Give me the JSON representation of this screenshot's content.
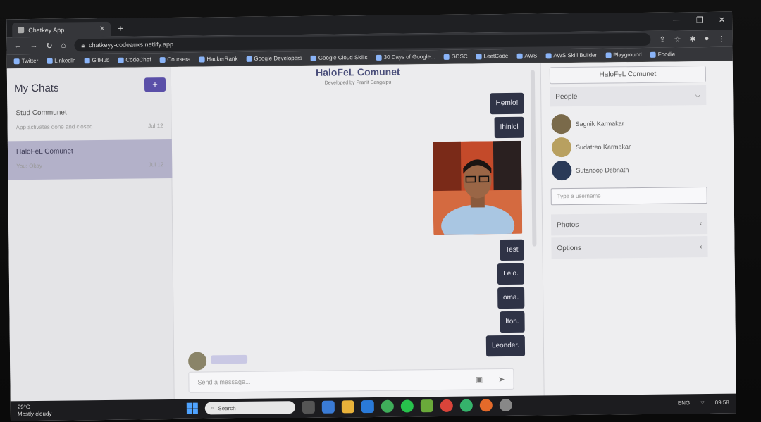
{
  "browser": {
    "tab_title": "Chatkey App",
    "url": "chatkeyy-codeauxs.netlify.app",
    "bookmarks": [
      "Twitter",
      "LinkedIn",
      "GitHub",
      "CodeChef",
      "Coursera",
      "HackerRank",
      "Google Developers",
      "Google Cloud Skills",
      "30 Days of Google...",
      "GDSC",
      "LeetCode",
      "AWS",
      "AWS Skill Builder",
      "Playground",
      "Foodie"
    ]
  },
  "sidebar": {
    "title": "My Chats",
    "add_label": "+",
    "chats": [
      {
        "name": "Stud Communet",
        "preview": "App activates done and closed",
        "time": "Jul 12"
      },
      {
        "name": "HaloFeL Comunet",
        "preview": "You: Okay",
        "time": "Jul 12"
      }
    ]
  },
  "conversation": {
    "title": "HaloFeL Comunet",
    "subtitle": "Developed by Pranit Sangalpu",
    "messages": [
      "Hemlo!",
      "Ihinlol",
      "Test",
      "Lelo.",
      "oma.",
      "Iton.",
      "Leonder."
    ],
    "composer_placeholder": "Send a message..."
  },
  "details": {
    "group_name": "HaloFeL Comunet",
    "people_label": "People",
    "people": [
      "Sagnik Karmakar",
      "Sudatreo Karmakar",
      "Sutanoop Debnath"
    ],
    "add_user_placeholder": "Type a username",
    "photos_label": "Photos",
    "options_label": "Options"
  },
  "taskbar": {
    "weather_temp": "29°C",
    "weather_desc": "Mostly cloudy",
    "search_label": "Search",
    "lang": "ENG",
    "time": "09:58"
  }
}
